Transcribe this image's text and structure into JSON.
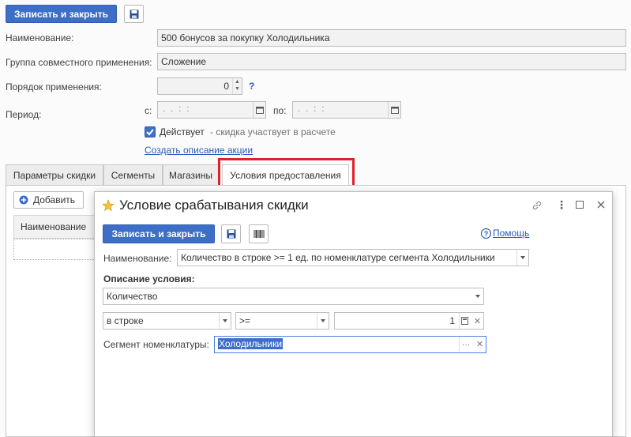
{
  "top": {
    "save_close_label": "Записать и закрыть",
    "name_label": "Наименование:",
    "name_value": "500 бонусов за покупку Холодильника",
    "group_label": "Группа совместного применения:",
    "group_value": "Сложение",
    "order_label": "Порядок применения:",
    "order_value": "0",
    "help_q": "?",
    "period_label": "Период:",
    "from_label": "с:",
    "to_label": "по:",
    "date_placeholder": ". .   : :",
    "active_label": "Действует",
    "active_hint": "- скидка участвует в расчете",
    "create_desc_link": "Создать описание акции"
  },
  "tabs": [
    {
      "label": "Параметры скидки"
    },
    {
      "label": "Сегменты"
    },
    {
      "label": "Магазины"
    },
    {
      "label": "Условия предоставления"
    }
  ],
  "list": {
    "add_label": "Добавить",
    "col_name": "Наименование"
  },
  "dialog": {
    "title": "Условие срабатывания скидки",
    "save_close_label": "Записать и закрыть",
    "help_label": "Помощь",
    "name_label": "Наименование:",
    "name_value": "Количество в строке >= 1 ед. по номенклатуре сегмента Холодильники",
    "desc_label": "Описание условия:",
    "kind_value": "Количество",
    "scope_value": "в строке",
    "op_value": ">=",
    "amount_value": "1",
    "segment_label": "Сегмент номенклатуры:",
    "segment_value": "Холодильники"
  },
  "colors": {
    "accent": "#3e6fc8",
    "link": "#2a5bb5",
    "highlight_frame": "#e0202c"
  }
}
